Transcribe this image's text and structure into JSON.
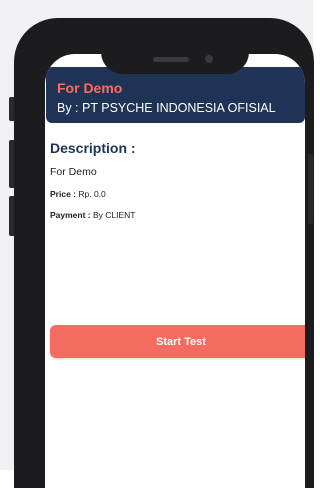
{
  "header": {
    "title": "For Demo",
    "subtitle": "By : PT PSYCHE INDONESIA OFISIAL"
  },
  "description": {
    "heading": "Description :",
    "text": "For Demo"
  },
  "price": {
    "label": "Price :",
    "value": " Rp. 0.0"
  },
  "payment": {
    "label": "Payment :",
    "value": " By CLIENT"
  },
  "actions": {
    "start_label": "Start Test"
  },
  "colors": {
    "header_bg": "#1f3357",
    "accent": "#f36c5f",
    "title_text": "#ff6b5a",
    "heading_text": "#1f3357"
  },
  "icons": {
    "speaker": "speaker-icon",
    "camera": "camera-icon"
  }
}
